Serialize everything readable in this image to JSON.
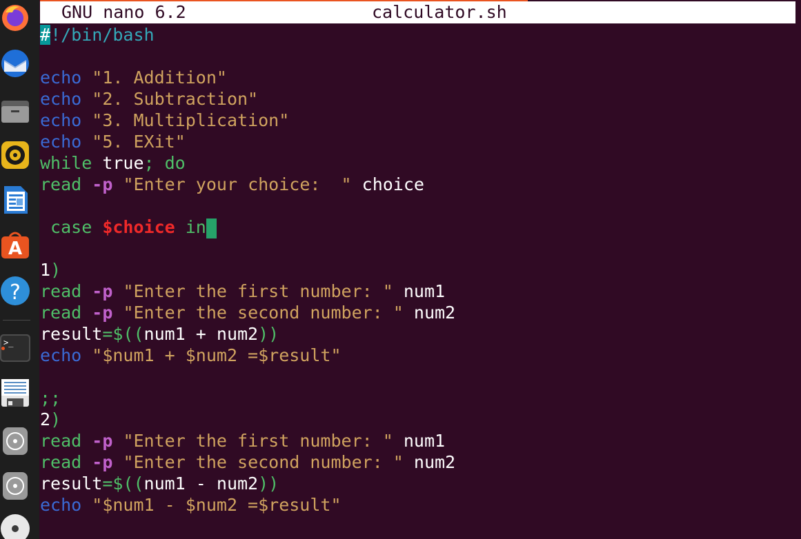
{
  "dock": {
    "items": [
      {
        "name": "firefox-icon"
      },
      {
        "name": "thunderbird-icon"
      },
      {
        "name": "files-icon"
      },
      {
        "name": "rhythmbox-icon"
      },
      {
        "name": "writer-icon"
      },
      {
        "name": "software-icon"
      },
      {
        "name": "help-icon"
      },
      {
        "name": "terminal-icon"
      },
      {
        "name": "text-editor-icon"
      },
      {
        "name": "disc-icon"
      },
      {
        "name": "disc-icon-2"
      },
      {
        "name": "cd-icon"
      }
    ]
  },
  "titlebar": {
    "app": "GNU nano 6.2",
    "filename": "calculator.sh"
  },
  "code": {
    "shebang_hash": "#",
    "shebang_rest": "!/bin/bash",
    "echo1_kw": "echo",
    "echo1_str": "\"1. Addition\"",
    "echo2_kw": "echo",
    "echo2_str": "\"2. Subtraction\"",
    "echo3_kw": "echo",
    "echo3_str": "\"3. Multiplication\"",
    "echo4_kw": "echo",
    "echo4_str": "\"5. EXit\"",
    "while_kw": "while",
    "while_true": " true",
    "while_rest": "; do",
    "read1_kw": "read",
    "read1_opt": "-p",
    "read1_str": "\"Enter your choice:  \"",
    "read1_var": " choice",
    "case_kw": " case ",
    "case_var": "$choice",
    "case_in": " in",
    "c1_num": "1",
    "c1_paren": ")",
    "r1_kw": "read",
    "r1_opt": "-p",
    "r1_str": "\"Enter the first number: \"",
    "r1_var": " num1",
    "r2_kw": "read",
    "r2_opt": "-p",
    "r2_str": "\"Enter the second number: \"",
    "r2_var": " num2",
    "res1_a": "result",
    "res1_b": "=$((",
    "res1_c": "num1 + num2",
    "res1_d": "))",
    "e1_kw": "echo",
    "e1_str": "\"$num1 + $num2 =$result\"",
    "dsemi": ";;",
    "c2_num": "2",
    "c2_paren": ")",
    "r3_kw": "read",
    "r3_opt": "-p",
    "r3_str": "\"Enter the first number: \"",
    "r3_var": " num1",
    "r4_kw": "read",
    "r4_opt": "-p",
    "r4_str": "\"Enter the second number: \"",
    "r4_var": " num2",
    "res2_a": "result",
    "res2_b": "=$((",
    "res2_c": "num1 - num2",
    "res2_d": "))",
    "e2_kw": "echo",
    "e2_str": "\"$num1 - $num2 =$result\""
  }
}
